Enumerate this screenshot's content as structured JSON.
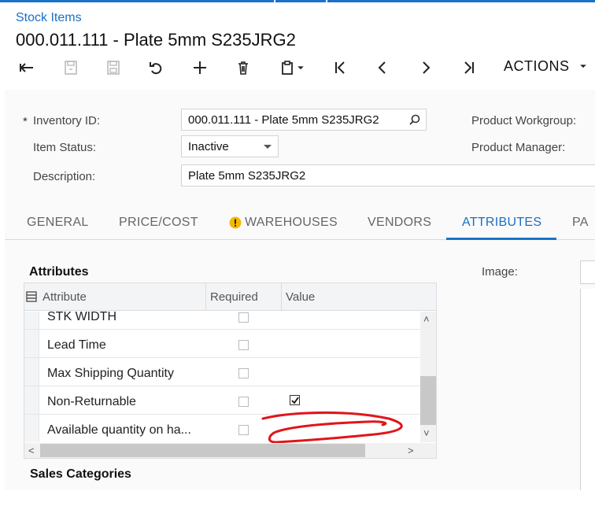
{
  "breadcrumb": "Stock Items",
  "title": "000.011.111 - Plate 5mm S235JRG2",
  "toolbar": {
    "actions_label": "ACTIONS"
  },
  "form": {
    "required_marker": "*",
    "inventory_id_label": "Inventory ID:",
    "inventory_id_value": "000.011.111 - Plate 5mm S235JRG2",
    "item_status_label": "Item Status:",
    "item_status_value": "Inactive",
    "description_label": "Description:",
    "description_value": "Plate 5mm S235JRG2",
    "product_workgroup_label": "Product Workgroup:",
    "product_manager_label": "Product Manager:"
  },
  "tabs": [
    "GENERAL",
    "PRICE/COST",
    "WAREHOUSES",
    "VENDORS",
    "ATTRIBUTES",
    "PA"
  ],
  "attributes": {
    "section_title": "Attributes",
    "columns": [
      "Attribute",
      "Required",
      "Value"
    ],
    "rows": [
      {
        "attribute": "STK WIDTH",
        "required": false,
        "value_checked": null
      },
      {
        "attribute": "Lead Time",
        "required": false,
        "value_checked": null
      },
      {
        "attribute": "Max Shipping Quantity",
        "required": false,
        "value_checked": null
      },
      {
        "attribute": "Non-Returnable",
        "required": false,
        "value_checked": true
      },
      {
        "attribute": "Available quantity on ha...",
        "required": false,
        "value_checked": null
      }
    ]
  },
  "image_label": "Image:",
  "sales_categories_title": "Sales Categories",
  "colors": {
    "accent": "#1a73c9",
    "warning": "#f5b800",
    "annotation": "#e0151b"
  }
}
